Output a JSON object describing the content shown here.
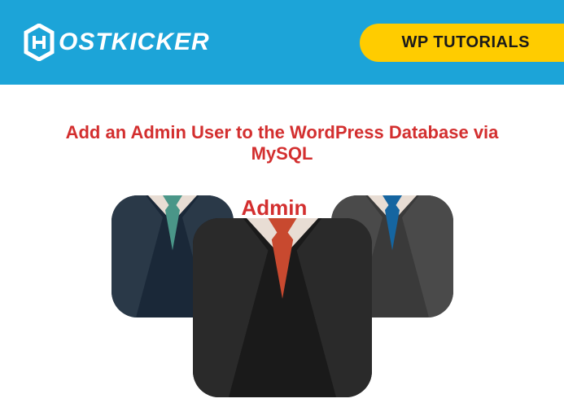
{
  "header": {
    "logo_text": "OSTKICKER",
    "badge": "WP TUTORIALS"
  },
  "content": {
    "title": "Add an Admin User to the WordPress Database via MySQL",
    "admin_label": "Admin"
  },
  "figures": {
    "left": {
      "tie_color": "#4a9688",
      "suit_color": "#1a2838"
    },
    "center": {
      "tie_color": "#c8492f",
      "suit_color": "#1a1a1a"
    },
    "right": {
      "tie_color": "#1565a0",
      "suit_color": "#3a3a3a"
    }
  }
}
